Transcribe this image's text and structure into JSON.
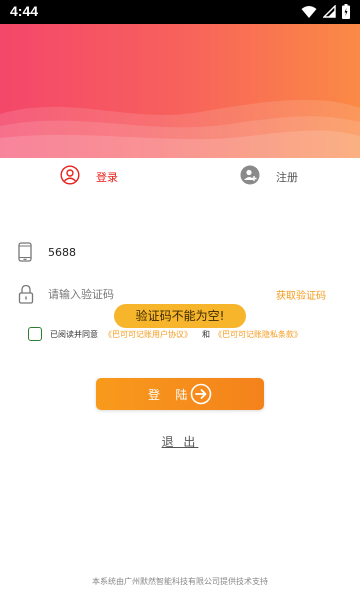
{
  "status_bar": {
    "time": "4:44",
    "icons": [
      "wifi-icon",
      "signal-icon",
      "battery-icon"
    ]
  },
  "tabs": {
    "login_label": "登录",
    "register_label": "注册",
    "active": "login"
  },
  "form": {
    "phone_value": "5688",
    "code_placeholder": "请输入验证码",
    "get_code_label": "获取验证码"
  },
  "toast": {
    "message": "验证码不能为空!"
  },
  "agreement": {
    "prefix": "已阅读并同意",
    "user_agreement": "《巴可可记账用户协议》",
    "conjunction": "和",
    "privacy_policy": "《巴可可记账隐私条款》",
    "checked": false
  },
  "login_button": {
    "label": "登 陆"
  },
  "logout_label": "退 出",
  "footer_text": "本系统由广州默然智能科技有限公司提供技术支持",
  "colors": {
    "accent": "#e8211b",
    "orange": "#f49a1c",
    "toast_bg": "#f7b52b",
    "checkbox_border": "#2e7d32",
    "banner_start": "#f4476a",
    "banner_end": "#fb8a45"
  }
}
